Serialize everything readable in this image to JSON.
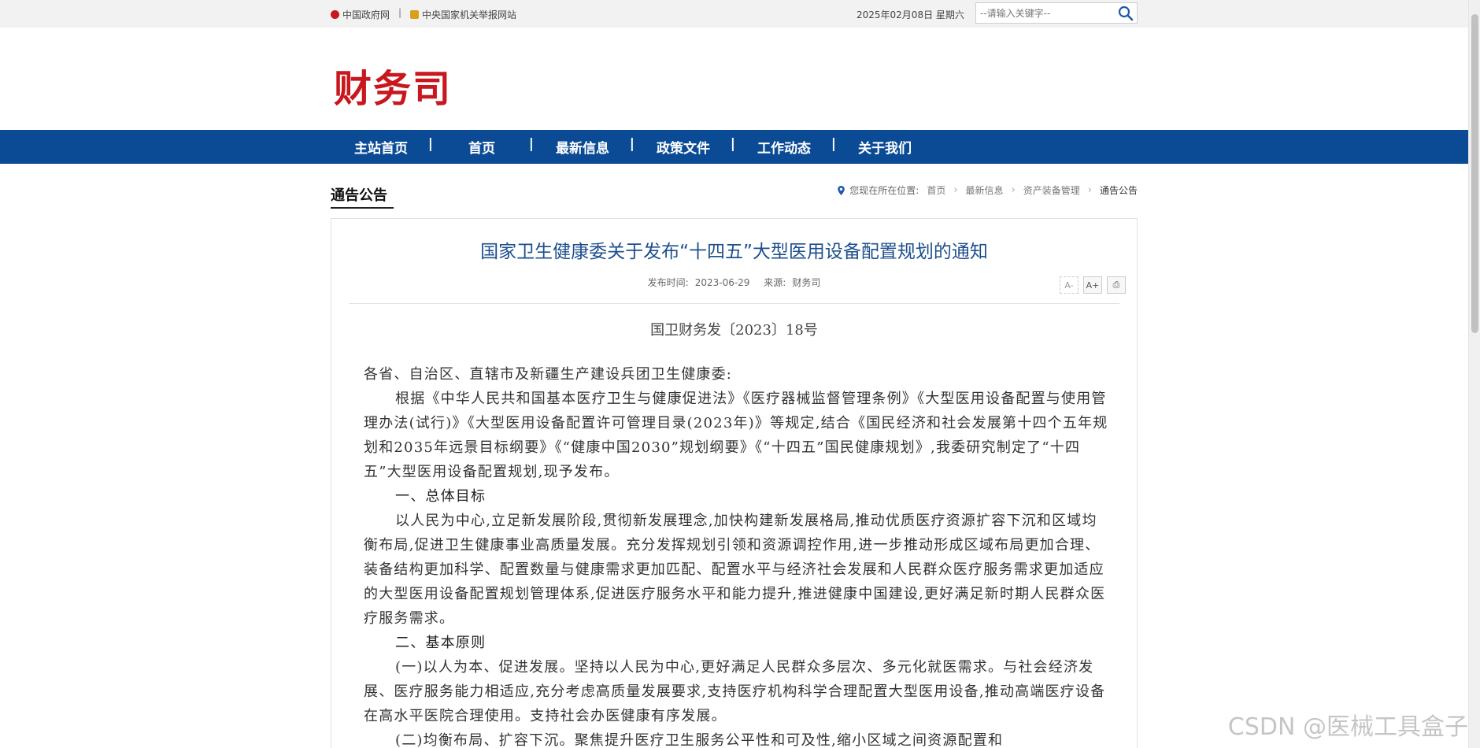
{
  "topbar": {
    "gov_link": "中国政府网",
    "separator": "|",
    "report_link": "中央国家机关举报网站",
    "date": "2025年02月08日 星期六",
    "search_placeholder": "--请输入关键字--"
  },
  "header": {
    "logo": "财务司"
  },
  "nav": {
    "items": [
      "主站首页",
      "首页",
      "最新信息",
      "政策文件",
      "工作动态",
      "关于我们"
    ]
  },
  "section": {
    "title": "通告公告",
    "breadcrumb_prefix": "您现在所在位置:",
    "crumbs": [
      "首页",
      "最新信息",
      "资产装备管理"
    ],
    "current": "通告公告"
  },
  "article": {
    "title": "国家卫生健康委关于发布“十四五”大型医用设备配置规划的通知",
    "publish_label": "发布时间:",
    "publish_date": "2023-06-29",
    "source_label": "来源:",
    "source": "财务司",
    "tools": {
      "font_smaller": "A-",
      "font_larger": "A+",
      "print": "⎙"
    },
    "doc_number": "国卫财务发〔2023〕18号",
    "paragraphs": [
      "各省、自治区、直辖市及新疆生产建设兵团卫生健康委:",
      "根据《中华人民共和国基本医疗卫生与健康促进法》《医疗器械监督管理条例》《大型医用设备配置与使用管理办法(试行)》《大型医用设备配置许可管理目录(2023年)》等规定,结合《国民经济和社会发展第十四个五年规划和2035年远景目标纲要》《“健康中国2030”规划纲要》《“十四五”国民健康规划》,我委研究制定了“十四五”大型医用设备配置规划,现予发布。",
      "一、总体目标",
      "以人民为中心,立足新发展阶段,贯彻新发展理念,加快构建新发展格局,推动优质医疗资源扩容下沉和区域均衡布局,促进卫生健康事业高质量发展。充分发挥规划引领和资源调控作用,进一步推动形成区域布局更加合理、装备结构更加科学、配置数量与健康需求更加匹配、配置水平与经济社会发展和人民群众医疗服务需求更加适应的大型医用设备配置规划管理体系,促进医疗服务水平和能力提升,推进健康中国建设,更好满足新时期人民群众医疗服务需求。",
      "二、基本原则",
      "(一)以人为本、促进发展。坚持以人民为中心,更好满足人民群众多层次、多元化就医需求。与社会经济发展、医疗服务能力相适应,充分考虑高质量发展要求,支持医疗机构科学合理配置大型医用设备,推动高端医疗设备在高水平医院合理使用。支持社会办医健康有序发展。",
      "(二)均衡布局、扩容下沉。聚焦提升医疗卫生服务公平性和可及性,缩小区域之间资源配置和"
    ]
  },
  "watermark": "CSDN @医械工具盒子"
}
